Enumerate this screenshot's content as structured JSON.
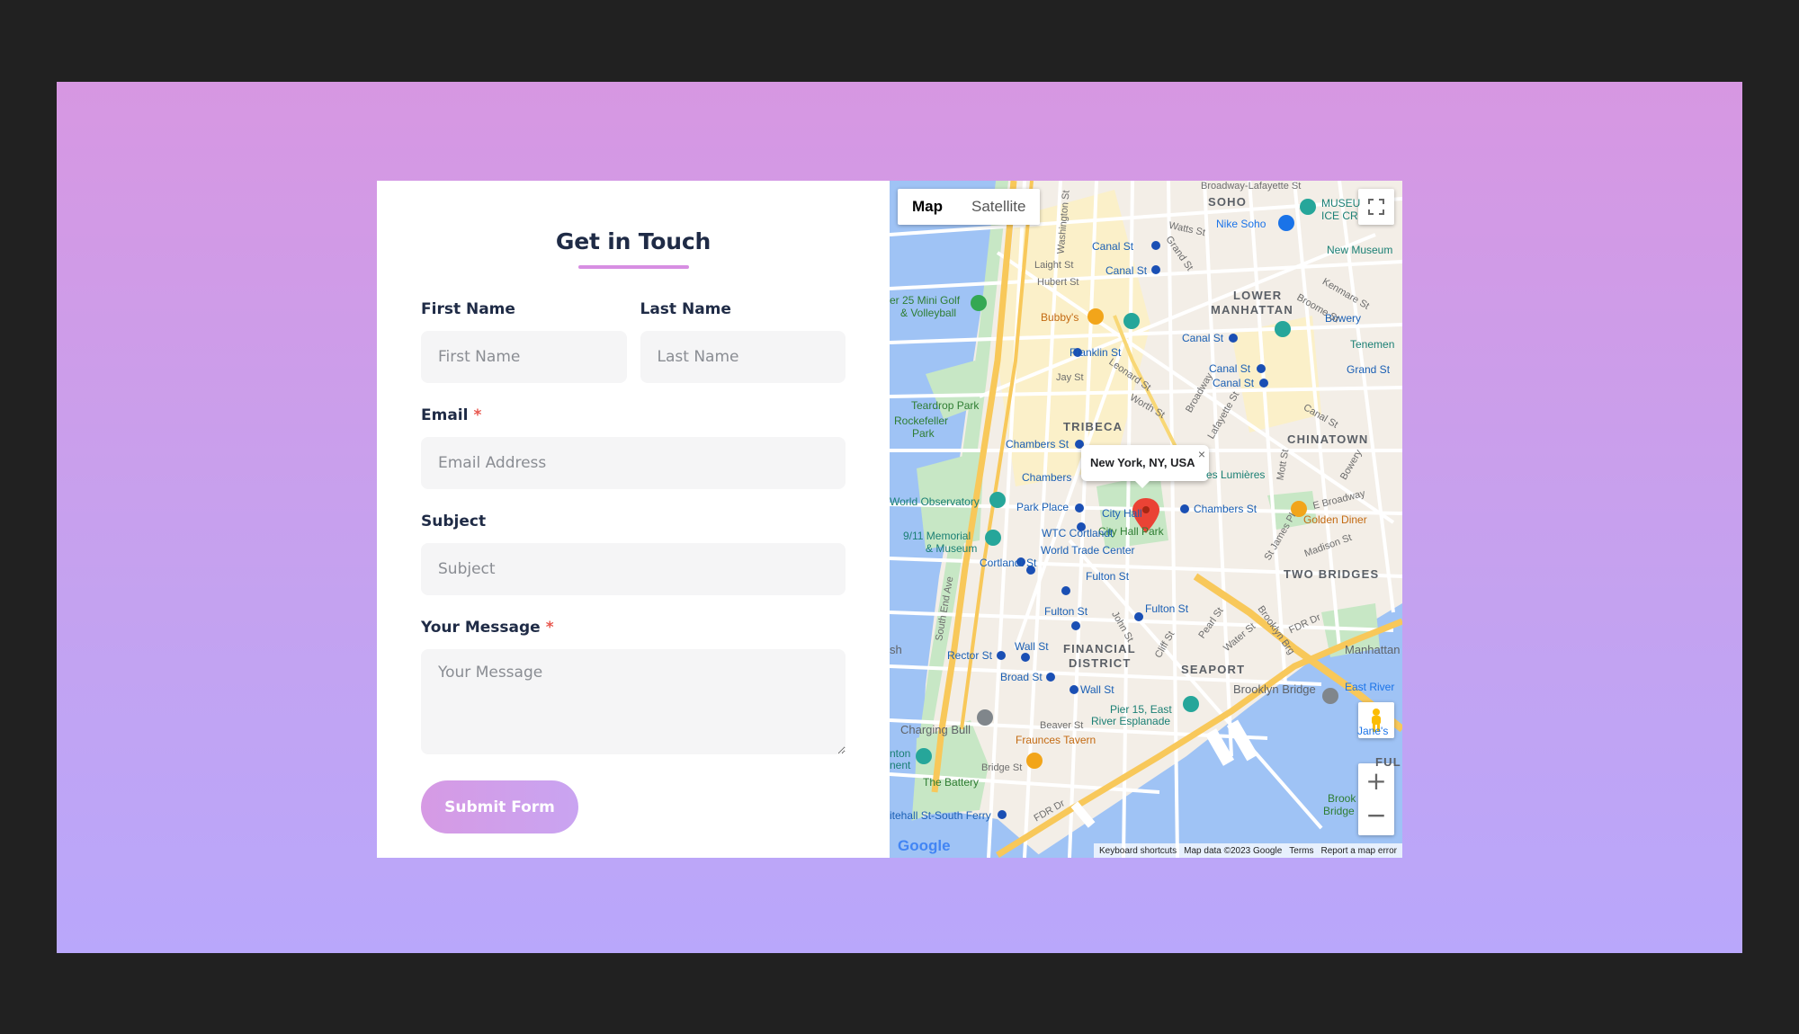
{
  "form": {
    "title_prefix": "Get in",
    "title_bold": "Touch",
    "first_name": {
      "label": "First Name",
      "placeholder": "First Name"
    },
    "last_name": {
      "label": "Last Name",
      "placeholder": "Last Name"
    },
    "email": {
      "label": "Email",
      "required_mark": "*",
      "placeholder": "Email Address"
    },
    "subject": {
      "label": "Subject",
      "placeholder": "Subject"
    },
    "message": {
      "label": "Your Message",
      "required_mark": "*",
      "placeholder": "Your Message"
    },
    "submit_label": "Submit Form"
  },
  "map": {
    "type_map": "Map",
    "type_satellite": "Satellite",
    "infowindow_text": "New York, NY, USA",
    "infowindow_close": "×",
    "google_logo": "Google",
    "attribution": {
      "shortcuts": "Keyboard shortcuts",
      "data": "Map data ©2023 Google",
      "terms": "Terms",
      "report": "Report a map error"
    },
    "zoom_in": "+",
    "zoom_out": "−",
    "districts": {
      "soho": "SOHO",
      "lower_manhattan_1": "LOWER",
      "lower_manhattan_2": "MANHATTAN",
      "tribeca": "TRIBECA",
      "chinatown": "CHINATOWN",
      "two_bridges": "TWO BRIDGES",
      "financial_1": "FINANCIAL",
      "financial_2": "DISTRICT",
      "seaport": "SEAPORT"
    },
    "places": {
      "museum_ice": "MUSEU",
      "museum_ice2": "ICE CR",
      "nike_soho": "Nike Soho",
      "new_museum": "New Museum",
      "bowery": "Bowery",
      "tenement": "Tenemen",
      "grand_st": "Grand St",
      "pier25_1": "er 25 Mini Golf",
      "pier25_2": "& Volleyball",
      "bubbys": "Bubby's",
      "teardrop": "Teardrop Park",
      "rockefeller_1": "Rockefeller",
      "rockefeller_2": "Park",
      "world_obs": "World Observatory",
      "memorial_1": "9/11 Memorial",
      "memorial_2": "& Museum",
      "city_hall": "City Hall",
      "city_hall_park": "City Hall Park",
      "golden_diner": "Golden Diner",
      "wtc": "World Trade Center",
      "wtc_cortlandt": "WTC Cortlandt",
      "cortlandt": "Cortlandt St",
      "park_place": "Park Place",
      "chambers1": "Chambers St",
      "chambers2": "Chambers",
      "chambers3": "Chambers St",
      "lumieres": "es Lumières",
      "franklin": "Franklin St",
      "canal1": "Canal St",
      "canal2": "Canal St",
      "canal3": "Canal St",
      "canal4": "Canal St",
      "canal5": "Canal St",
      "fulton1": "Fulton St",
      "fulton2": "Fulton St",
      "fulton3": "Fulton St",
      "wall1": "Wall St",
      "wall2": "Wall St",
      "rector": "Rector St",
      "broad": "Broad St",
      "charging_bull": "Charging Bull",
      "fraunces": "Fraunces Tavern",
      "pier15_1": "Pier 15, East",
      "pier15_2": "River Esplanade",
      "brooklyn_bridge": "Brooklyn Bridge",
      "east_river": "East River",
      "janes": "Jane's",
      "manhattan": "Manhattan",
      "ful": "FUL",
      "brook_1": "Brook",
      "brook_2": "Bridge",
      "battery": "The Battery",
      "ferry": "itehall St-South Ferry",
      "nton_1": "nton",
      "nton_2": "nent",
      "sh": "sh"
    },
    "streets": {
      "broadway_lafayette": "Broadway-Lafayette St",
      "watts": "Watts St",
      "laight": "Laight St",
      "hubert": "Hubert St",
      "jay": "Jay St",
      "worth": "Worth St",
      "broadway": "Broadway",
      "lafayette": "Lafayette St",
      "kenmare": "Kenmare St",
      "broome": "Broome St",
      "canal_st": "Canal St",
      "e_broadway": "E Broadway",
      "pearl": "Pearl St",
      "water": "Water St",
      "fdr1": "FDR Dr",
      "fdr2": "FDR Dr",
      "brooklyn_brg": "Brooklyn Brg",
      "beaver": "Beaver St",
      "bridge_st": "Bridge St",
      "south_end": "South End Ave",
      "cliff": "Cliff St",
      "john": "John St",
      "madison": "Madison St",
      "st_james": "St James Pl",
      "washington": "Washington St",
      "grand": "Grand St",
      "leonard": "Leonard St",
      "bowery_st": "Bowery",
      "mott": "Mott St"
    }
  }
}
